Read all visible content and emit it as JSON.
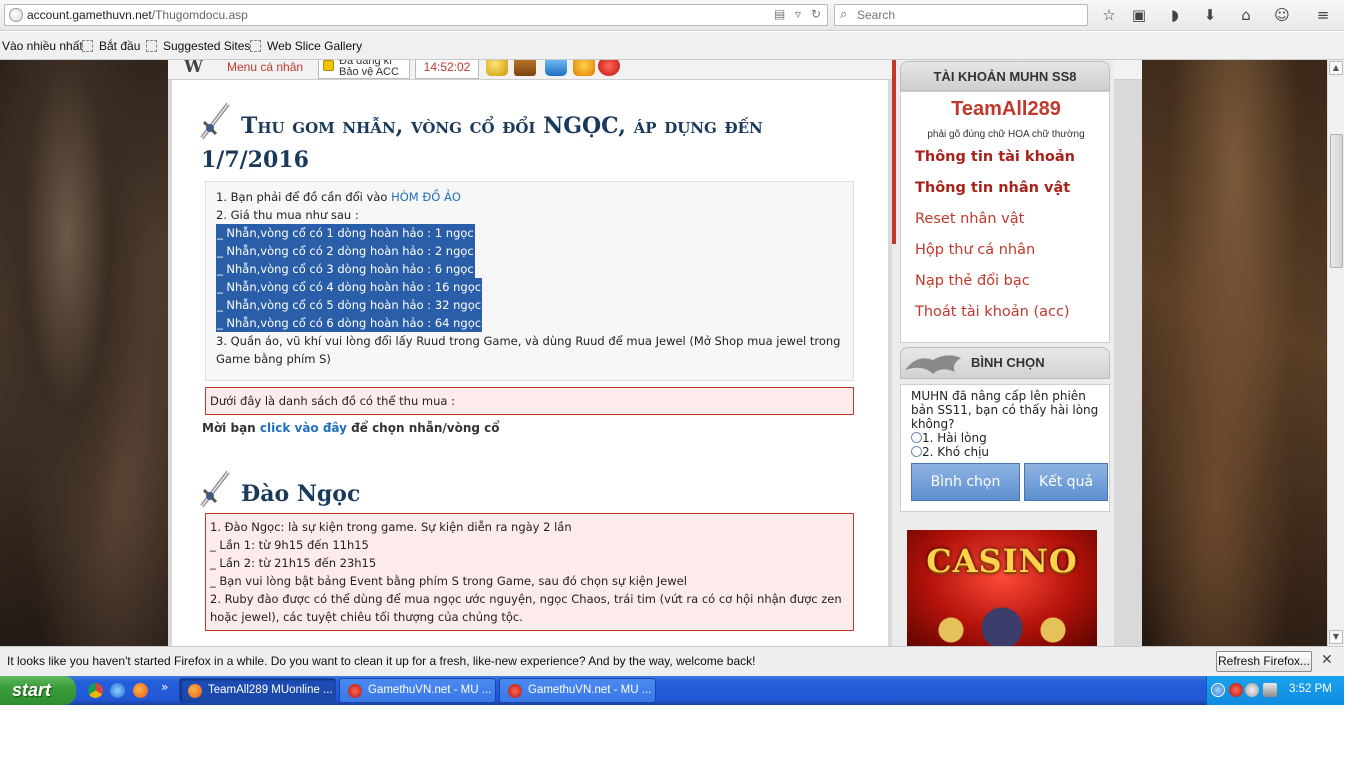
{
  "browser": {
    "url_host": "account.gamethuvn.net",
    "url_path": "/Thugomdocu.asp",
    "search_placeholder": "Search",
    "bookmarks": [
      "Vào nhiều nhất",
      "Bắt đầu",
      "Suggested Sites",
      "Web Slice Gallery"
    ]
  },
  "site_toolbar": {
    "menu_label": "Menu cá nhân",
    "acc_label": "Đã đăng kí Bảo vệ ACC",
    "clock": "14:52:02"
  },
  "section1": {
    "title_line1": "Thu gom nhẫn, vòng cổ đổi NGỌC, áp dụng đến",
    "title_line2": "1/7/2016",
    "line1_prefix": "1. Bạn phải để đồ cần đổi vào ",
    "line1_link": "HÒM ĐỒ ẢO",
    "line2": "2. Giá thu mua như sau :",
    "prices": [
      "_ Nhẫn,vòng cổ có 1 dòng hoàn hảo : 1 ngọc",
      "_ Nhẫn,vòng cổ có 2 dòng hoàn hảo : 2 ngọc",
      "_ Nhẫn,vòng cổ có 3 dòng hoàn hảo : 6 ngọc",
      "_ Nhẫn,vòng cổ có 4 dòng hoàn hảo : 16 ngọc",
      "_ Nhẫn,vòng cổ có 5 dòng hoàn hảo : 32 ngọc",
      "_ Nhẫn,vòng cổ có 6 dòng hoàn hảo : 64 ngọc"
    ],
    "line3": "3. Quần áo, vũ khí vui lòng đổi lấy Ruud trong Game, và dùng Ruud để mua Jewel (Mở Shop mua jewel trong Game bằng phím S)",
    "list_notice": "Dưới đây là danh sách đồ có thể thu mua :",
    "prompt_prefix": "Mời bạn ",
    "prompt_link": "click vào đây",
    "prompt_suffix": " để chọn nhẫn/vòng cổ"
  },
  "section2": {
    "title": "Đào Ngọc",
    "lines": [
      "1. Đào Ngọc: là sự kiện trong game. Sự kiện diễn ra ngày 2 lần",
      "_ Lần 1: từ 9h15 đến 11h15",
      "_ Lần 2: từ 21h15 đến 23h15",
      "_ Bạn vui lòng bật bảng Event bằng phím S trong Game, sau đó chọn sự kiện Jewel",
      "2. Ruby đào được có thể dùng để mua ngọc ước nguyện, ngọc Chaos, trái tim (vứt ra có cơ hội nhận được zen hoặc jewel), các tuyệt chiêu tối thượng của chủng tộc."
    ]
  },
  "sidebar": {
    "account_header": "TÀI KHOẢN MUHN SS8",
    "username": "TeamAll289",
    "username_note": "phải gõ đúng chữ HOA chữ thường",
    "links": [
      "Thông tin tài khoản",
      "Thông tin nhân vật",
      "Reset nhân vật",
      "Hộp thư cá nhân",
      "Nạp thẻ đổi bạc",
      "Thoát tài khoản (acc)"
    ],
    "vote_header": "BÌNH CHỌN",
    "vote_question": "MUHN đã nâng cấp lên phiên bản SS11, bạn có thấy hài lòng không?",
    "vote_options": [
      "1. Hài lòng",
      "2. Khó chịu"
    ],
    "vote_button": "Bình chọn",
    "result_button": "Kết quả",
    "banner_text": "CASINO"
  },
  "notification": {
    "message": "It looks like you haven't started Firefox in a while. Do you want to clean it up for a fresh, like-new experience? And by the way, welcome back!",
    "button": "Refresh Firefox..."
  },
  "taskbar": {
    "start_label": "start",
    "tasks": [
      "TeamAll289 MUonline ...",
      "GamethuVN.net - MU ...",
      "GamethuVN.net - MU ..."
    ],
    "clock": "3:52 PM"
  },
  "colors": {
    "accent_red": "#c0392b",
    "heading_blue": "#1a3a5c",
    "highlight_blue": "#2a5ea8",
    "link_blue": "#1e6fbf"
  }
}
